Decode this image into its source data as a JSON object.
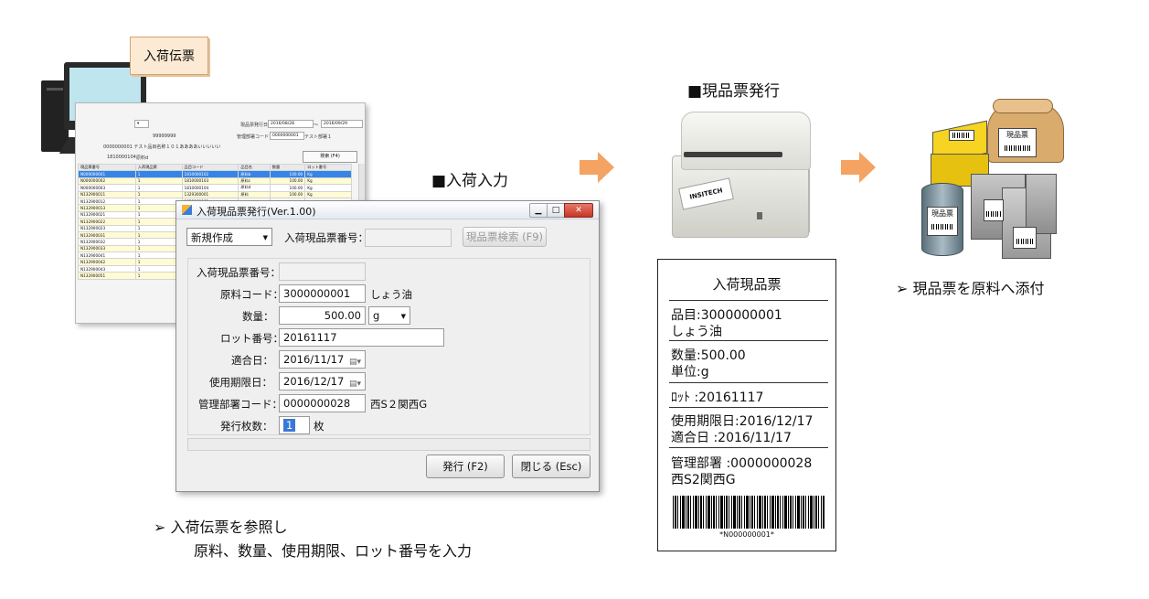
{
  "slip_tag": "入荷伝票",
  "bg_window": {
    "issue_date_label": "現品票発行日：",
    "issue_date_from": "2016/08/28",
    "range_sep": "～",
    "issue_date_to": "2016/09/29",
    "dept_code_label": "管理部署コード：",
    "dept_code": "0000000001",
    "dept_name": "テスト部署１",
    "code_partial": "99999999",
    "row_a": "0000000001 テスト品目名称１０１ああああいいいいい",
    "row_b_code": "1810000104",
    "row_b_name": "原料d",
    "search_button": "検索 (F4)",
    "columns": [
      "現品票番号",
      "入荷現品票",
      "品目コード",
      "品目名",
      "数量",
      "ロット番号"
    ],
    "rows": [
      [
        "N000000001",
        "1",
        "1810000102",
        "原料b",
        "100.00",
        "Kg"
      ],
      [
        "N000000002",
        "1",
        "1810000103",
        "原料c",
        "100.00",
        "Kg"
      ],
      [
        "N000000003",
        "1",
        "1810000104",
        "原料d",
        "100.00",
        "Kg"
      ],
      [
        "N132900011",
        "1",
        "1329300001",
        "原料",
        "100.00",
        "Kg"
      ],
      [
        "N132900012",
        "1",
        "1329300001",
        "",
        "",
        ""
      ],
      [
        "N132900013",
        "1",
        "1329300001",
        "",
        "",
        ""
      ],
      [
        "N132900021",
        "1",
        "1329300002",
        "",
        "",
        ""
      ],
      [
        "N132900022",
        "1",
        "1329300002",
        "",
        "",
        ""
      ],
      [
        "N132900023",
        "1",
        "1329300002",
        "",
        "",
        ""
      ],
      [
        "N132900031",
        "1",
        "1329300003",
        "",
        "",
        ""
      ],
      [
        "N132900032",
        "1",
        "1329300003",
        "",
        "",
        ""
      ],
      [
        "N132900033",
        "1",
        "1329300003",
        "",
        "",
        ""
      ],
      [
        "N132900041",
        "1",
        "1329300004",
        "",
        "",
        ""
      ],
      [
        "N132900042",
        "1",
        "1329300004",
        "",
        "",
        ""
      ],
      [
        "N132900043",
        "1",
        "1329300004",
        "",
        "",
        ""
      ],
      [
        "N132900051",
        "1",
        "1329300005",
        "",
        "",
        ""
      ]
    ]
  },
  "dialog": {
    "title": "入荷現品票発行(Ver.1.00)",
    "mode_select": "新規作成",
    "slip_no_label": "入荷現品票番号：",
    "slip_no_value": "",
    "search_button": "現品票検索 (F9)",
    "inner_slip_no_label": "入荷現品票番号：",
    "inner_slip_no_value": "",
    "material_code_label": "原料コード：",
    "material_code": "3000000001",
    "material_name": "しょう油",
    "quantity_label": "数量：",
    "quantity": "500.00",
    "unit": "g",
    "lot_label": "ロット番号：",
    "lot": "20161117",
    "fit_date_label": "適合日：",
    "fit_date": "2016/11/17",
    "expiry_label": "使用期限日：",
    "expiry": "2016/12/17",
    "dept_label": "管理部署コード：",
    "dept_code": "0000000028",
    "dept_name": "西S２関西G",
    "copies_label": "発行枚数：",
    "copies": "1",
    "copies_unit": "枚",
    "issue_button": "発行 (F2)",
    "close_button": "閉じる (Esc)"
  },
  "labels": {
    "entry": "■入荷入力",
    "issue": "■現品票発行"
  },
  "printer_paper": "INSITECH",
  "ticket": {
    "title": "入荷現品票",
    "item_line": "品目:3000000001",
    "item_name": "しょう油",
    "qty_line": "数量:500.00",
    "unit_line": "単位:g",
    "lot_line": "ﾛｯﾄ  :20161117",
    "expiry_line": "使用期限日:2016/12/17",
    "fit_line": "適合日      :2016/11/17",
    "dept_line": "管理部署  :0000000028",
    "dept_name_line": "西S2関西G",
    "barcode_text": "*N000000001*"
  },
  "materials_tags": [
    "現品票",
    "現品票"
  ],
  "notes": {
    "left_line1": "➢   入荷伝票を参照し",
    "left_line2": "原料、数量、使用期限、ロット番号を入力",
    "right": "➢    現品票を原料へ添付"
  }
}
